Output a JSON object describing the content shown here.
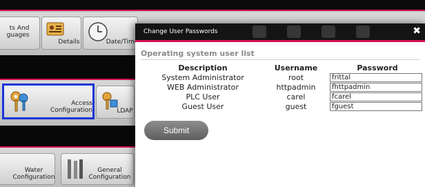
{
  "background": {
    "tiles": {
      "top_left": "ts And\nguages",
      "details": "Details",
      "datetime": "Date/Time",
      "access": "Access Configuration",
      "ldap": "LDAP",
      "water": "Water\nConfiguration",
      "general": "General\nConfiguration"
    }
  },
  "modal": {
    "title": "Change User Passwords",
    "section_title": "Operating system user list",
    "headers": {
      "description": "Description",
      "username": "Username",
      "password": "Password"
    },
    "rows": [
      {
        "description": "System Administrator",
        "username": "root",
        "password": "frittal"
      },
      {
        "description": "WEB Administrator",
        "username": "httpadmin",
        "password": "fhttpadmin"
      },
      {
        "description": "PLC User",
        "username": "carel",
        "password": "fcarel"
      },
      {
        "description": "Guest User",
        "username": "guest",
        "password": "fguest"
      }
    ],
    "submit_label": "Submit",
    "close_symbol": "✖"
  },
  "colors": {
    "accent_pink": "#d6124f",
    "selection_blue": "#1a35d8",
    "header_black": "#141414"
  }
}
